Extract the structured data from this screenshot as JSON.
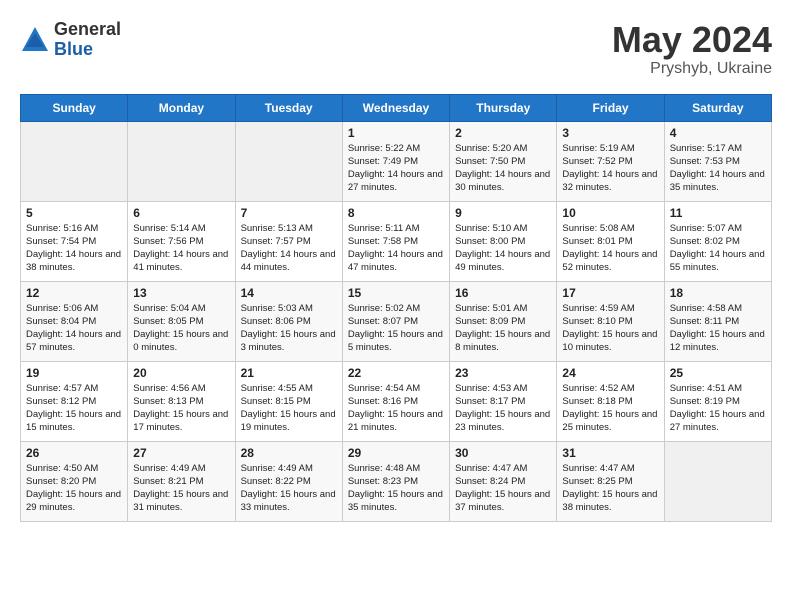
{
  "logo": {
    "general": "General",
    "blue": "Blue"
  },
  "title": "May 2024",
  "subtitle": "Pryshyb, Ukraine",
  "days_of_week": [
    "Sunday",
    "Monday",
    "Tuesday",
    "Wednesday",
    "Thursday",
    "Friday",
    "Saturday"
  ],
  "weeks": [
    [
      {
        "day": "",
        "empty": true
      },
      {
        "day": "",
        "empty": true
      },
      {
        "day": "",
        "empty": true
      },
      {
        "day": "1",
        "sunrise": "Sunrise: 5:22 AM",
        "sunset": "Sunset: 7:49 PM",
        "daylight": "Daylight: 14 hours and 27 minutes."
      },
      {
        "day": "2",
        "sunrise": "Sunrise: 5:20 AM",
        "sunset": "Sunset: 7:50 PM",
        "daylight": "Daylight: 14 hours and 30 minutes."
      },
      {
        "day": "3",
        "sunrise": "Sunrise: 5:19 AM",
        "sunset": "Sunset: 7:52 PM",
        "daylight": "Daylight: 14 hours and 32 minutes."
      },
      {
        "day": "4",
        "sunrise": "Sunrise: 5:17 AM",
        "sunset": "Sunset: 7:53 PM",
        "daylight": "Daylight: 14 hours and 35 minutes."
      }
    ],
    [
      {
        "day": "5",
        "sunrise": "Sunrise: 5:16 AM",
        "sunset": "Sunset: 7:54 PM",
        "daylight": "Daylight: 14 hours and 38 minutes."
      },
      {
        "day": "6",
        "sunrise": "Sunrise: 5:14 AM",
        "sunset": "Sunset: 7:56 PM",
        "daylight": "Daylight: 14 hours and 41 minutes."
      },
      {
        "day": "7",
        "sunrise": "Sunrise: 5:13 AM",
        "sunset": "Sunset: 7:57 PM",
        "daylight": "Daylight: 14 hours and 44 minutes."
      },
      {
        "day": "8",
        "sunrise": "Sunrise: 5:11 AM",
        "sunset": "Sunset: 7:58 PM",
        "daylight": "Daylight: 14 hours and 47 minutes."
      },
      {
        "day": "9",
        "sunrise": "Sunrise: 5:10 AM",
        "sunset": "Sunset: 8:00 PM",
        "daylight": "Daylight: 14 hours and 49 minutes."
      },
      {
        "day": "10",
        "sunrise": "Sunrise: 5:08 AM",
        "sunset": "Sunset: 8:01 PM",
        "daylight": "Daylight: 14 hours and 52 minutes."
      },
      {
        "day": "11",
        "sunrise": "Sunrise: 5:07 AM",
        "sunset": "Sunset: 8:02 PM",
        "daylight": "Daylight: 14 hours and 55 minutes."
      }
    ],
    [
      {
        "day": "12",
        "sunrise": "Sunrise: 5:06 AM",
        "sunset": "Sunset: 8:04 PM",
        "daylight": "Daylight: 14 hours and 57 minutes."
      },
      {
        "day": "13",
        "sunrise": "Sunrise: 5:04 AM",
        "sunset": "Sunset: 8:05 PM",
        "daylight": "Daylight: 15 hours and 0 minutes."
      },
      {
        "day": "14",
        "sunrise": "Sunrise: 5:03 AM",
        "sunset": "Sunset: 8:06 PM",
        "daylight": "Daylight: 15 hours and 3 minutes."
      },
      {
        "day": "15",
        "sunrise": "Sunrise: 5:02 AM",
        "sunset": "Sunset: 8:07 PM",
        "daylight": "Daylight: 15 hours and 5 minutes."
      },
      {
        "day": "16",
        "sunrise": "Sunrise: 5:01 AM",
        "sunset": "Sunset: 8:09 PM",
        "daylight": "Daylight: 15 hours and 8 minutes."
      },
      {
        "day": "17",
        "sunrise": "Sunrise: 4:59 AM",
        "sunset": "Sunset: 8:10 PM",
        "daylight": "Daylight: 15 hours and 10 minutes."
      },
      {
        "day": "18",
        "sunrise": "Sunrise: 4:58 AM",
        "sunset": "Sunset: 8:11 PM",
        "daylight": "Daylight: 15 hours and 12 minutes."
      }
    ],
    [
      {
        "day": "19",
        "sunrise": "Sunrise: 4:57 AM",
        "sunset": "Sunset: 8:12 PM",
        "daylight": "Daylight: 15 hours and 15 minutes."
      },
      {
        "day": "20",
        "sunrise": "Sunrise: 4:56 AM",
        "sunset": "Sunset: 8:13 PM",
        "daylight": "Daylight: 15 hours and 17 minutes."
      },
      {
        "day": "21",
        "sunrise": "Sunrise: 4:55 AM",
        "sunset": "Sunset: 8:15 PM",
        "daylight": "Daylight: 15 hours and 19 minutes."
      },
      {
        "day": "22",
        "sunrise": "Sunrise: 4:54 AM",
        "sunset": "Sunset: 8:16 PM",
        "daylight": "Daylight: 15 hours and 21 minutes."
      },
      {
        "day": "23",
        "sunrise": "Sunrise: 4:53 AM",
        "sunset": "Sunset: 8:17 PM",
        "daylight": "Daylight: 15 hours and 23 minutes."
      },
      {
        "day": "24",
        "sunrise": "Sunrise: 4:52 AM",
        "sunset": "Sunset: 8:18 PM",
        "daylight": "Daylight: 15 hours and 25 minutes."
      },
      {
        "day": "25",
        "sunrise": "Sunrise: 4:51 AM",
        "sunset": "Sunset: 8:19 PM",
        "daylight": "Daylight: 15 hours and 27 minutes."
      }
    ],
    [
      {
        "day": "26",
        "sunrise": "Sunrise: 4:50 AM",
        "sunset": "Sunset: 8:20 PM",
        "daylight": "Daylight: 15 hours and 29 minutes."
      },
      {
        "day": "27",
        "sunrise": "Sunrise: 4:49 AM",
        "sunset": "Sunset: 8:21 PM",
        "daylight": "Daylight: 15 hours and 31 minutes."
      },
      {
        "day": "28",
        "sunrise": "Sunrise: 4:49 AM",
        "sunset": "Sunset: 8:22 PM",
        "daylight": "Daylight: 15 hours and 33 minutes."
      },
      {
        "day": "29",
        "sunrise": "Sunrise: 4:48 AM",
        "sunset": "Sunset: 8:23 PM",
        "daylight": "Daylight: 15 hours and 35 minutes."
      },
      {
        "day": "30",
        "sunrise": "Sunrise: 4:47 AM",
        "sunset": "Sunset: 8:24 PM",
        "daylight": "Daylight: 15 hours and 37 minutes."
      },
      {
        "day": "31",
        "sunrise": "Sunrise: 4:47 AM",
        "sunset": "Sunset: 8:25 PM",
        "daylight": "Daylight: 15 hours and 38 minutes."
      },
      {
        "day": "",
        "empty": true
      }
    ]
  ]
}
